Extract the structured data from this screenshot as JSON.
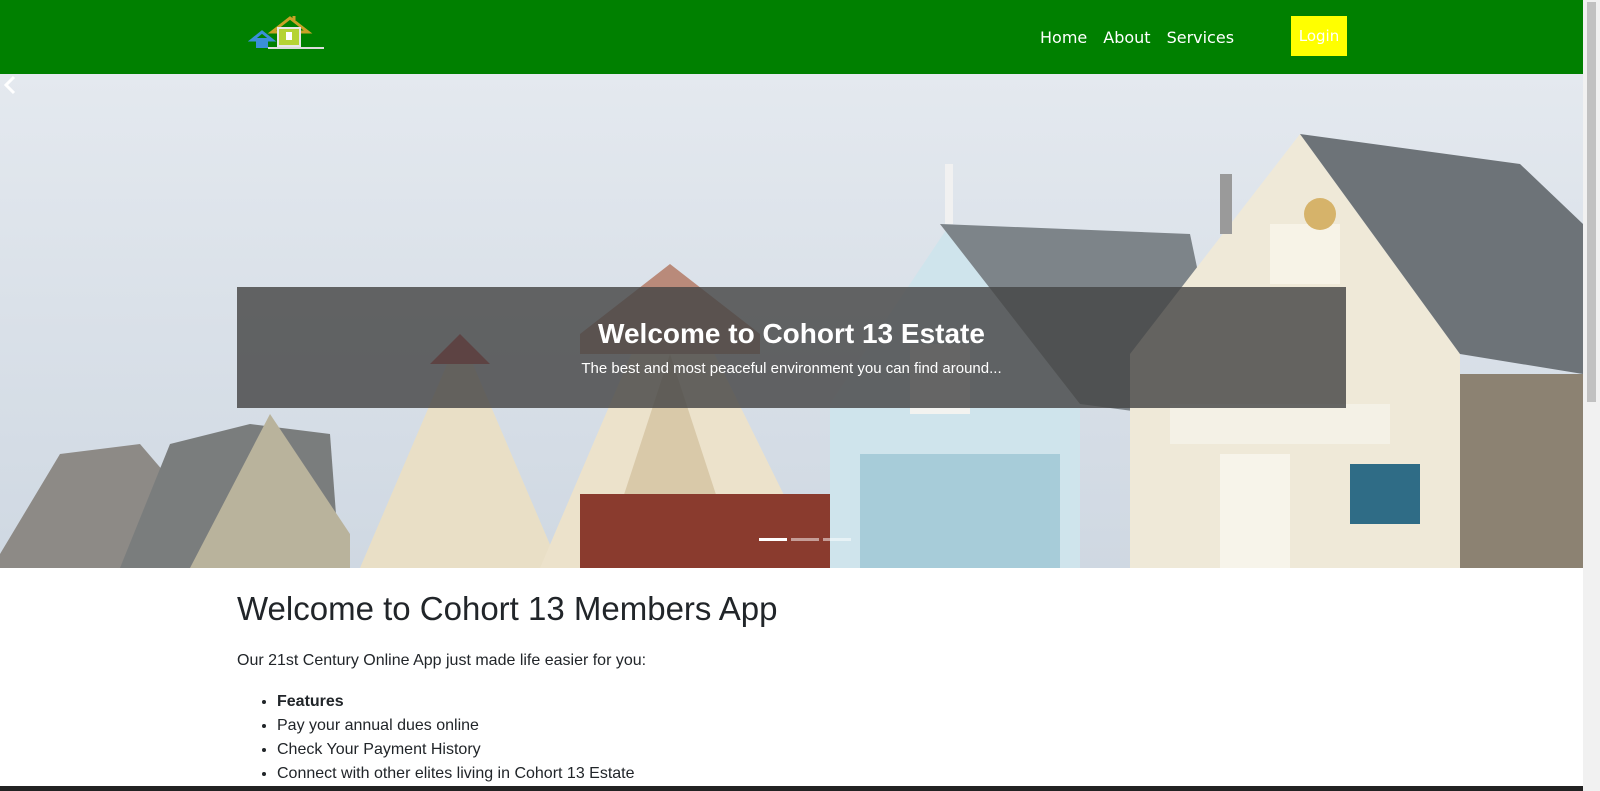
{
  "navbar": {
    "logo_icon": "house-logo-icon",
    "links": [
      "Home",
      "About",
      "Services"
    ],
    "login_label": "Login",
    "bg_color": "#008000",
    "login_color": "#ffff00"
  },
  "hero": {
    "title": "Welcome to Cohort 13 Estate",
    "subtitle": "The best and most peaceful environment you can find around...",
    "prev_icon": "chevron-left-icon",
    "indicator_count": 3,
    "active_indicator": 1
  },
  "main": {
    "heading": "Welcome to Cohort 13 Members App",
    "intro": "Our 21st Century Online App just made life easier for you:",
    "features_title": "Features",
    "features": [
      "Pay your annual dues online",
      "Check Your Payment History",
      "Connect with other elites living in Cohort 13 Estate"
    ]
  }
}
